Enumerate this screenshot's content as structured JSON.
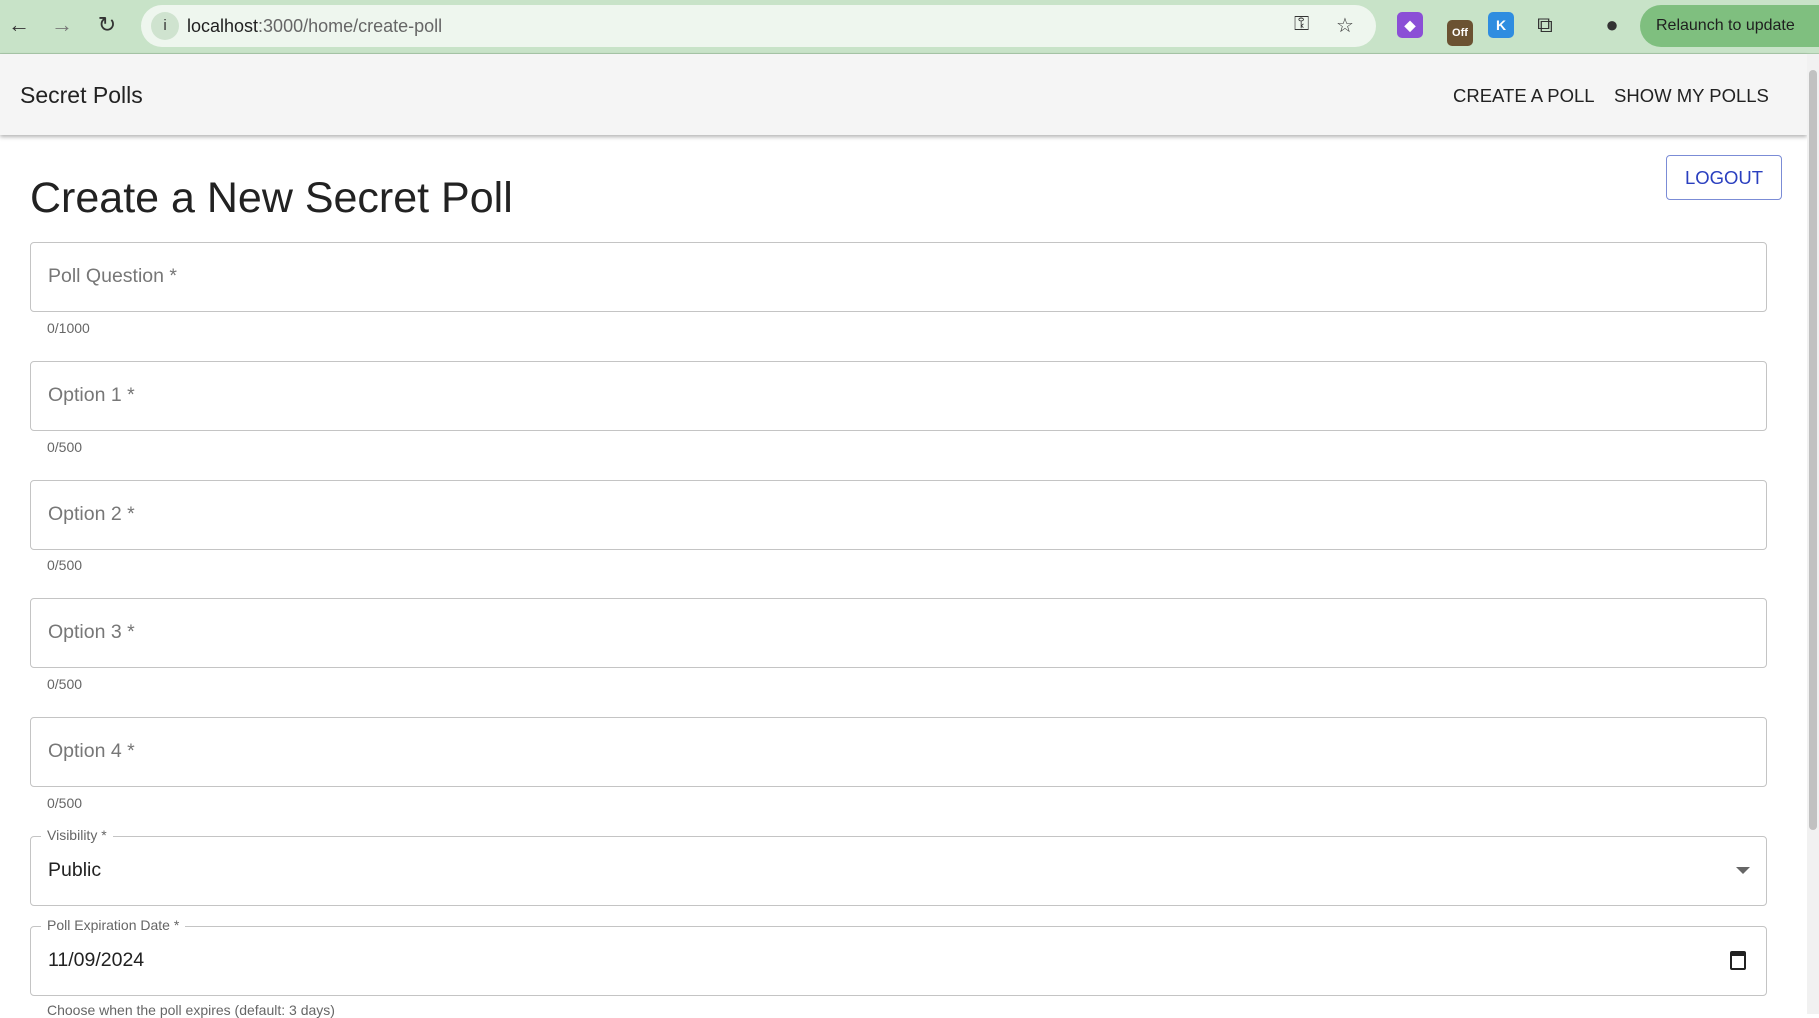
{
  "browser": {
    "url_host": "localhost",
    "url_path": ":3000/home/create-poll",
    "relaunch_label": "Relaunch to update",
    "ext_off_label": "Off",
    "ext_k_label": "K"
  },
  "appbar": {
    "title": "Secret Polls",
    "nav": [
      {
        "label": "CREATE A POLL"
      },
      {
        "label": "SHOW MY POLLS"
      }
    ]
  },
  "logout_label": "LOGOUT",
  "page_title": "Create a New Secret Poll",
  "fields": [
    {
      "placeholder": "Poll Question *",
      "helper": "0/1000"
    },
    {
      "placeholder": "Option 1 *",
      "helper": "0/500"
    },
    {
      "placeholder": "Option 2 *",
      "helper": "0/500"
    },
    {
      "placeholder": "Option 3 *",
      "helper": "0/500"
    },
    {
      "placeholder": "Option 4 *",
      "helper": "0/500"
    }
  ],
  "visibility": {
    "label": "Visibility *",
    "value": "Public"
  },
  "expiration": {
    "label": "Poll Expiration Date *",
    "value": "11/09/2024",
    "helper": "Choose when the poll expires (default: 3 days)"
  },
  "colors": {
    "accent": "#2a3fbf",
    "browser_frame": "#c8e3c8"
  }
}
